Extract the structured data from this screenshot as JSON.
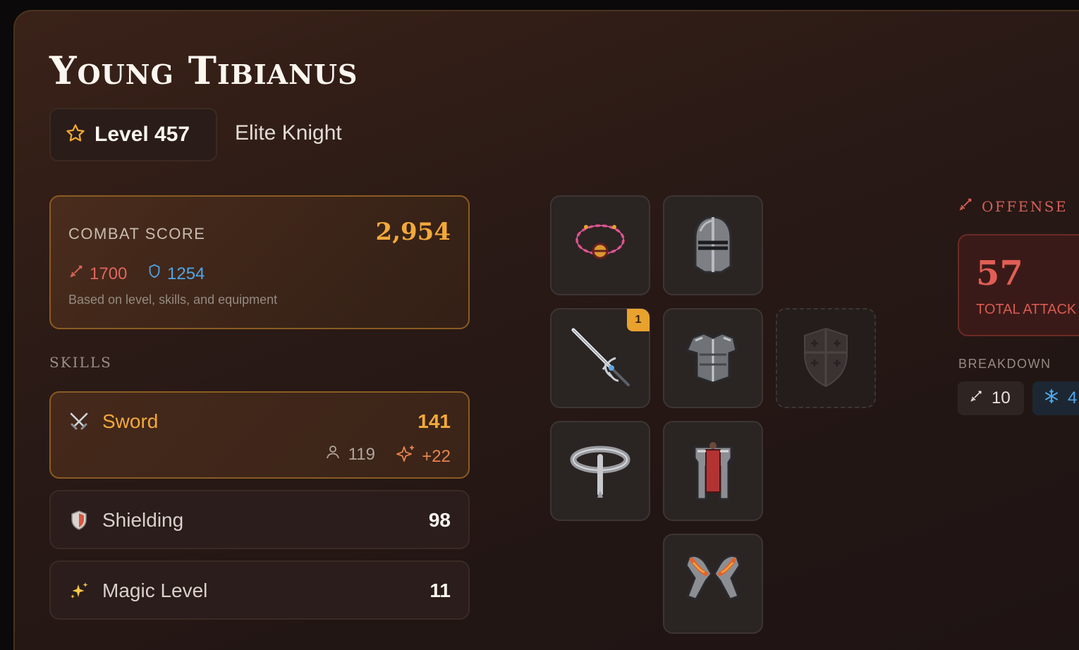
{
  "character": {
    "name": "Young Tibianus",
    "level_label": "Level 457",
    "vocation": "Elite Knight"
  },
  "combat_score": {
    "label": "COMBAT SCORE",
    "value": "2,954",
    "offense": "1700",
    "defense": "1254",
    "description": "Based on level, skills, and equipment"
  },
  "skills": {
    "title": "SKILLS",
    "items": [
      {
        "name": "Sword",
        "value": "141",
        "base": "119",
        "bonus": "+22",
        "icon": "crossed-swords-icon"
      },
      {
        "name": "Shielding",
        "value": "98",
        "icon": "shield-icon"
      },
      {
        "name": "Magic Level",
        "value": "11",
        "icon": "sparkles-icon"
      }
    ]
  },
  "equipment": {
    "slots": [
      {
        "slot": "amulet",
        "icon": "amulet-icon"
      },
      {
        "slot": "helmet",
        "icon": "helmet-icon"
      },
      {
        "slot": "weapon",
        "icon": "sword-icon",
        "badge": "1"
      },
      {
        "slot": "armor",
        "icon": "armor-icon"
      },
      {
        "slot": "shield",
        "icon": "shield-empty-icon",
        "empty": true
      },
      {
        "slot": "ring",
        "icon": "ring-icon"
      },
      {
        "slot": "legs",
        "icon": "legs-icon"
      },
      {
        "slot": "boots",
        "icon": "boots-icon"
      }
    ]
  },
  "offense": {
    "title": "OFFENSE",
    "total_attack": "57",
    "total_attack_label": "TOTAL ATTACK",
    "breakdown_label": "BREAKDOWN",
    "physical": "10",
    "ice": "4"
  },
  "colors": {
    "accent_gold": "#f3a93a",
    "offense_red": "#e06660",
    "defense_blue": "#4fa6e8"
  }
}
